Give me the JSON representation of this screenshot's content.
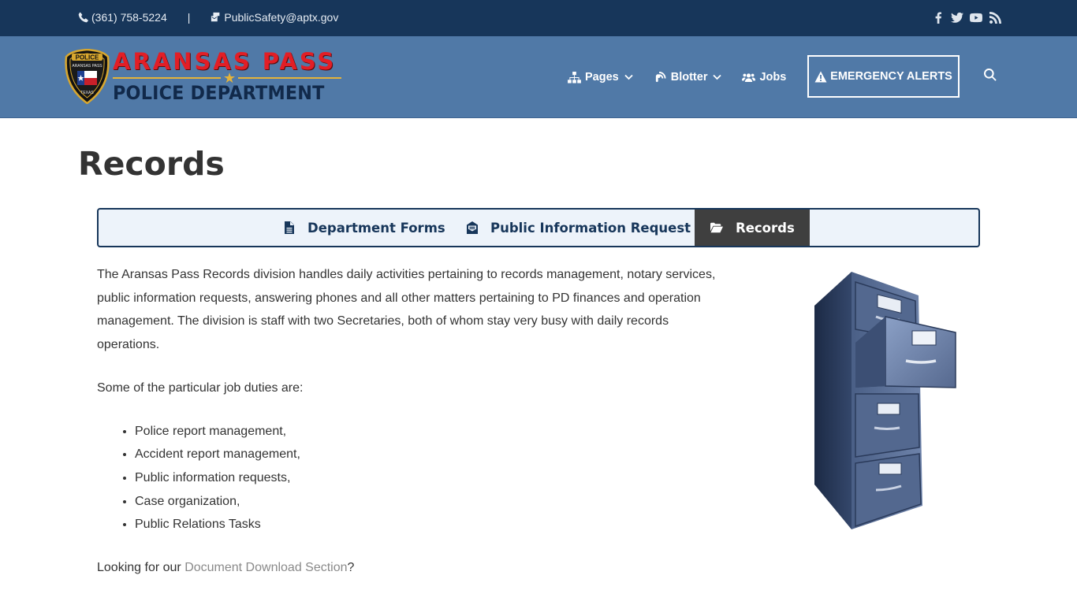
{
  "topbar": {
    "phone": "(361) 758-5224",
    "separator": "|",
    "email": "PublicSafety@aptx.gov",
    "social_icons": [
      "facebook-icon",
      "twitter-icon",
      "youtube-icon",
      "rss-icon"
    ]
  },
  "logo": {
    "line1": "ARANSAS PASS",
    "line2": "POLICE DEPARTMENT",
    "badge_top": "POLICE",
    "badge_ring": "ARANSAS PASS",
    "badge_bottom": "TEXAS"
  },
  "nav": {
    "items": [
      {
        "label": "Pages",
        "icon": "sitemap-icon",
        "dropdown": true
      },
      {
        "label": "Blotter",
        "icon": "blog-icon",
        "dropdown": true
      },
      {
        "label": "Jobs",
        "icon": "users-icon",
        "dropdown": false
      }
    ],
    "alerts_label": "EMERGENCY ALERTS"
  },
  "page": {
    "title": "Records"
  },
  "tabs": [
    {
      "label": "Department Forms",
      "icon": "file-icon",
      "active": false
    },
    {
      "label": "Public Information Request",
      "icon": "envelope-open-icon",
      "active": false
    },
    {
      "label": "Records",
      "icon": "folder-open-icon",
      "active": true
    }
  ],
  "content": {
    "intro": "The Aransas Pass Records division handles daily activities pertaining to records management, notary services, public information requests, answering phones and all other matters pertaining to PD finances and operation management.  The division is staff with two Secretaries, both of whom stay very busy with daily records operations.",
    "duties_heading": "Some of the particular job duties are:",
    "duties": [
      "Police report management,",
      "Accident report management,",
      "Public information requests,",
      "Case organization,",
      "Public Relations Tasks"
    ],
    "footer_prefix": "Looking for our ",
    "footer_link": "Document Download Section",
    "footer_suffix": "?"
  },
  "colors": {
    "topbar": "#17365a",
    "header": "#5079a7",
    "logo_red": "#e21e26",
    "logo_navy": "#11294a",
    "tab_active": "#3f3f3f",
    "tab_bg": "#edf3fa"
  }
}
